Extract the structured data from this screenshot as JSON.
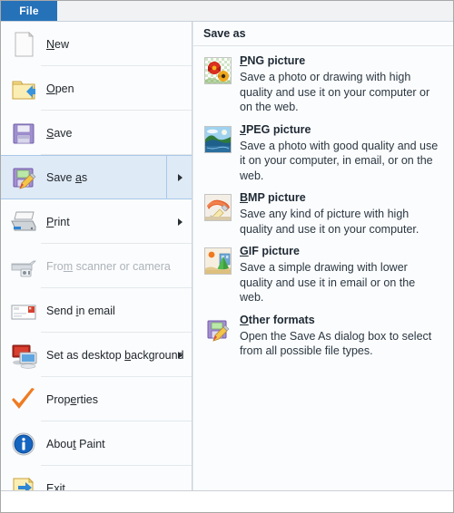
{
  "window": {
    "app_name": "Paint",
    "tab_label": "File",
    "accent_color": "#2672b9",
    "selected_row_bg": "#dfeaf7"
  },
  "file_menu": {
    "items": [
      {
        "label_pre": "",
        "label_accel": "N",
        "label_post": "ew",
        "full": "New",
        "icon": "new-document-icon",
        "disabled": false,
        "has_submenu": false,
        "selected": false
      },
      {
        "label_pre": "",
        "label_accel": "O",
        "label_post": "pen",
        "full": "Open",
        "icon": "open-folder-icon",
        "disabled": false,
        "has_submenu": false,
        "selected": false
      },
      {
        "label_pre": "",
        "label_accel": "S",
        "label_post": "ave",
        "full": "Save",
        "icon": "floppy-disk-icon",
        "disabled": false,
        "has_submenu": false,
        "selected": false
      },
      {
        "label_pre": "Save ",
        "label_accel": "a",
        "label_post": "s",
        "full": "Save as",
        "icon": "floppy-pencil-icon",
        "disabled": false,
        "has_submenu": true,
        "selected": true
      },
      {
        "label_pre": "",
        "label_accel": "P",
        "label_post": "rint",
        "full": "Print",
        "icon": "printer-icon",
        "disabled": false,
        "has_submenu": true,
        "selected": false
      },
      {
        "label_pre": "Fro",
        "label_accel": "m",
        "label_post": " scanner or camera",
        "full": "From scanner or camera",
        "icon": "scanner-icon",
        "disabled": true,
        "has_submenu": false,
        "selected": false
      },
      {
        "label_pre": "Send ",
        "label_accel": "i",
        "label_post": "n email",
        "full": "Send in email",
        "icon": "envelope-icon",
        "disabled": false,
        "has_submenu": false,
        "selected": false
      },
      {
        "label_pre": "Set as desktop ",
        "label_accel": "b",
        "label_post": "ackground",
        "full": "Set as desktop background",
        "icon": "desktop-monitors-icon",
        "disabled": false,
        "has_submenu": true,
        "selected": false
      },
      {
        "label_pre": "Prop",
        "label_accel": "e",
        "label_post": "rties",
        "full": "Properties",
        "icon": "orange-checkmark-icon",
        "disabled": false,
        "has_submenu": false,
        "selected": false
      },
      {
        "label_pre": "Abou",
        "label_accel": "t",
        "label_post": " Paint",
        "full": "About Paint",
        "icon": "info-circle-icon",
        "disabled": false,
        "has_submenu": false,
        "selected": false
      },
      {
        "label_pre": "E",
        "label_accel": "x",
        "label_post": "it",
        "full": "Exit",
        "icon": "exit-folder-arrow-icon",
        "disabled": false,
        "has_submenu": false,
        "selected": false
      }
    ]
  },
  "save_as_panel": {
    "header": "Save as",
    "formats": [
      {
        "title_accel": "P",
        "title_rest": "NG picture",
        "title_full": "PNG picture",
        "description": "Save a photo or drawing with high quality and use it on your computer or on the web.",
        "icon": "png-flowers-icon"
      },
      {
        "title_accel": "J",
        "title_rest": "PEG picture",
        "title_full": "JPEG picture",
        "description": "Save a photo with good quality and use it on your computer, in email, or on the web.",
        "icon": "jpeg-landscape-icon"
      },
      {
        "title_accel": "B",
        "title_rest": "MP picture",
        "title_full": "BMP picture",
        "description": "Save any kind of picture with high quality and use it on your computer.",
        "icon": "bmp-paint-icon"
      },
      {
        "title_accel": "G",
        "title_rest": "IF picture",
        "title_full": "GIF picture",
        "description": "Save a simple drawing with lower quality and use it in email or on the web.",
        "icon": "gif-drawing-icon"
      },
      {
        "title_accel": "O",
        "title_rest": "ther formats",
        "title_full": "Other formats",
        "description": "Open the Save As dialog box to select from all possible file types.",
        "icon": "floppy-pencil-icon"
      }
    ]
  }
}
